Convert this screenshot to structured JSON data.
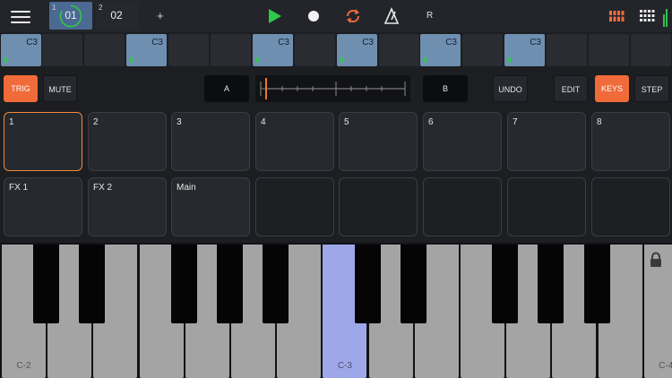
{
  "topbar": {
    "menu_icon": "hamburger-icon",
    "patterns": [
      {
        "number": "1",
        "name": "01",
        "selected": true
      },
      {
        "number": "2",
        "name": "02",
        "selected": false
      }
    ],
    "add_label": "+",
    "record_mode_label": "R",
    "colors": {
      "play": "#2ec84a",
      "loop": "#f06a3a",
      "accent": "#f06a3a"
    }
  },
  "steps": {
    "note": "C3",
    "cells": [
      true,
      false,
      false,
      true,
      false,
      false,
      true,
      false,
      true,
      false,
      true,
      false,
      true,
      false,
      false,
      false
    ]
  },
  "controls": {
    "trig_label": "TRIG",
    "mute_label": "MUTE",
    "a_label": "A",
    "b_label": "B",
    "undo_label": "UNDO",
    "edit_label": "EDIT",
    "keys_label": "KEYS",
    "step_label": "STEP"
  },
  "pads": {
    "tracks": [
      "1",
      "2",
      "3",
      "4",
      "5",
      "6",
      "7",
      "8"
    ],
    "buses": [
      "FX 1",
      "FX 2",
      "Main",
      "",
      "",
      "",
      "",
      ""
    ]
  },
  "keyboard": {
    "low_label": "C-2",
    "mid_label": "C-3",
    "high_label": "C-4",
    "active_color": "#9ea8e8"
  }
}
